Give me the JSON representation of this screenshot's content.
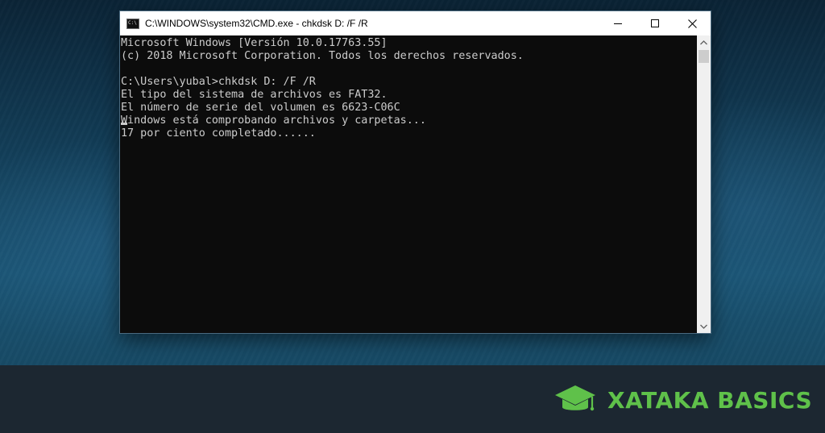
{
  "window": {
    "title": "C:\\WINDOWS\\system32\\CMD.exe - chkdsk  D: /F /R",
    "app_icon": "cmd-icon",
    "controls": {
      "minimize_icon": "minimize-icon",
      "maximize_icon": "maximize-icon",
      "close_icon": "close-icon"
    }
  },
  "console": {
    "lines": [
      "Microsoft Windows [Versión 10.0.17763.55]",
      "(c) 2018 Microsoft Corporation. Todos los derechos reservados.",
      "",
      "C:\\Users\\yubal>chkdsk D: /F /R",
      "El tipo del sistema de archivos es FAT32.",
      "El número de serie del volumen es 6623-C06C",
      "Windows está comprobando archivos y carpetas...",
      "17 por ciento completado......"
    ],
    "colors": {
      "background": "#0c0c0c",
      "text": "#cccccc"
    }
  },
  "footer": {
    "brand_name": "XATAKA BASICS",
    "brand_icon": "graduation-cap-icon",
    "brand_color": "#5fc14a"
  }
}
